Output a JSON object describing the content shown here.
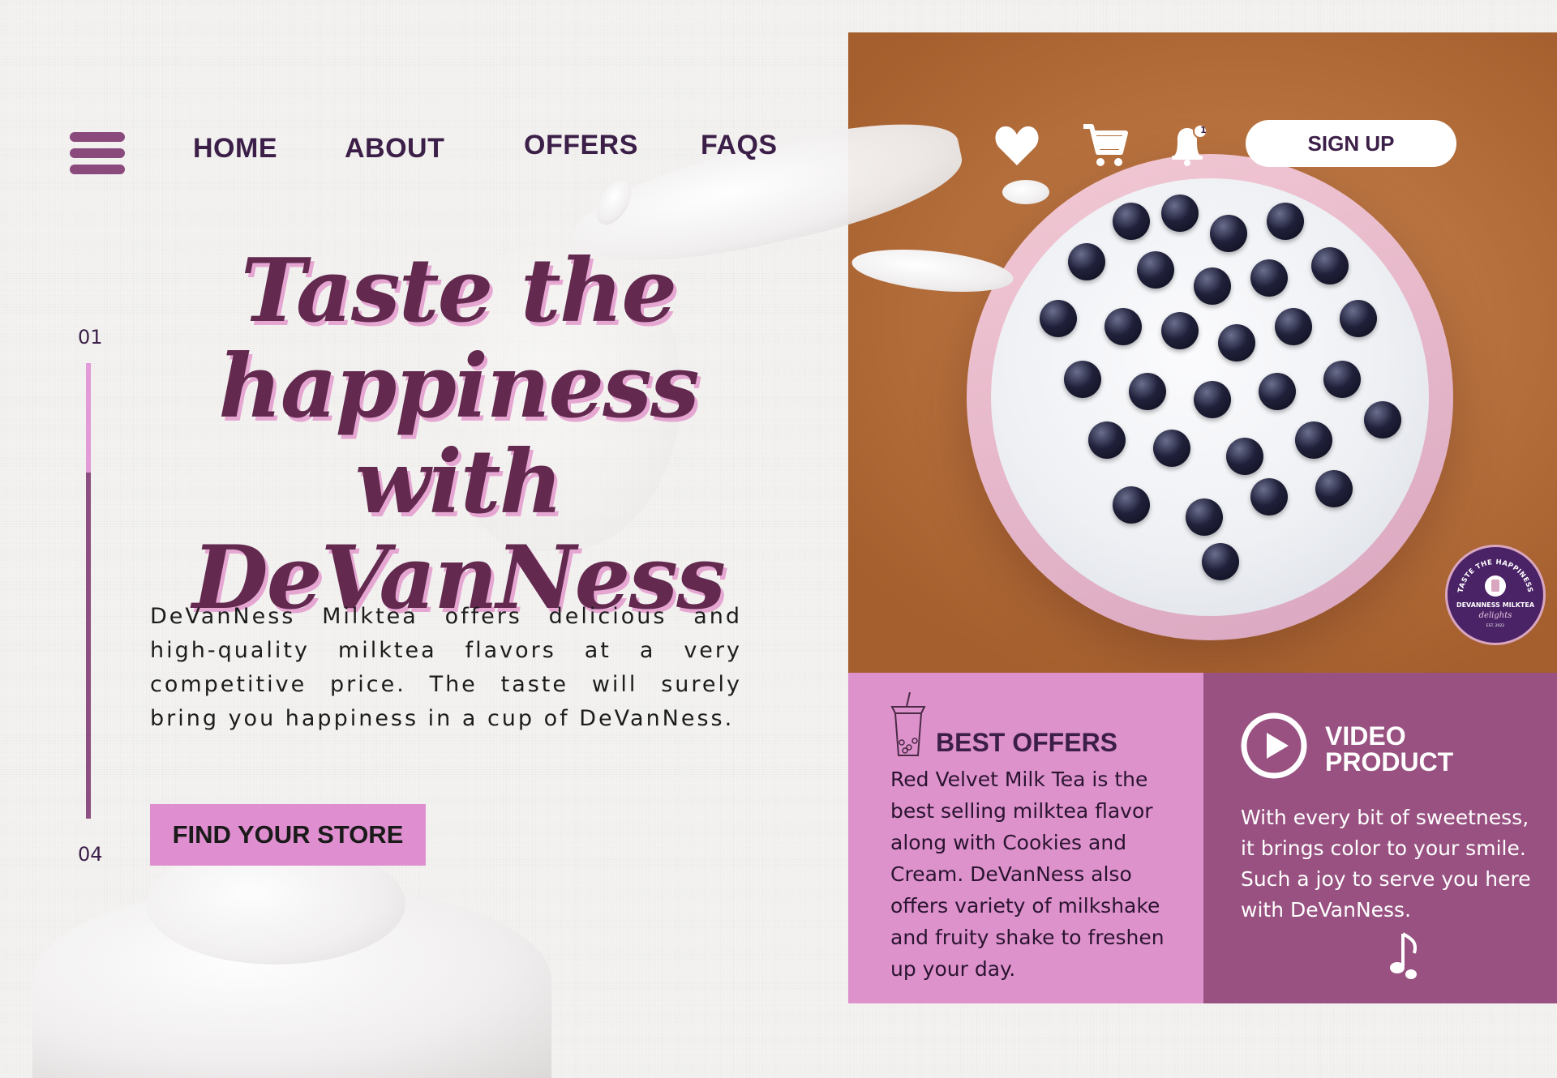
{
  "nav": {
    "links": [
      "HOME",
      "ABOUT",
      "OFFERS",
      "FAQS"
    ],
    "signup_label": "SIGN UP",
    "notification_count": "1",
    "icons": [
      "menu-icon",
      "heart-icon",
      "cart-icon",
      "bell-icon"
    ]
  },
  "hero": {
    "headline_line1": "Taste the",
    "headline_line2": "happiness with",
    "headline_line3": "DeVanNess",
    "description": "DeVanNess Milktea offers delicious and high-quality milktea flavors at a very competitive price. The taste will surely bring you happiness in a cup of DeVanNess.",
    "cta_label": "FIND YOUR STORE"
  },
  "pager": {
    "current": "01",
    "total": "04"
  },
  "badge": {
    "arc_text": "TASTE THE HAPPINESS",
    "brand": "DEVANNESS MILKTEA",
    "script": "delights",
    "est": "EST. 2022"
  },
  "cards": {
    "offers": {
      "title": "BEST OFFERS",
      "text": "Red Velvet Milk Tea is the best selling milktea flavor along with Cookies and Cream.  DeVanNess also offers variety of milkshake and fruity shake to freshen up your day.",
      "icon": "bubble-tea-icon"
    },
    "video": {
      "title_line1": "VIDEO",
      "title_line2": "PRODUCT",
      "text": "With every bit of sweetness, it brings color to your smile. Such a joy to serve you here with DeVanNess.",
      "icons": [
        "play-icon",
        "music-note-icon"
      ]
    }
  },
  "colors": {
    "primary": "#63294f",
    "accent_pink": "#de92cc",
    "accent_plum": "#985180",
    "nav_text": "#3c1f48",
    "headline_shadow": "#e6a6d2"
  }
}
